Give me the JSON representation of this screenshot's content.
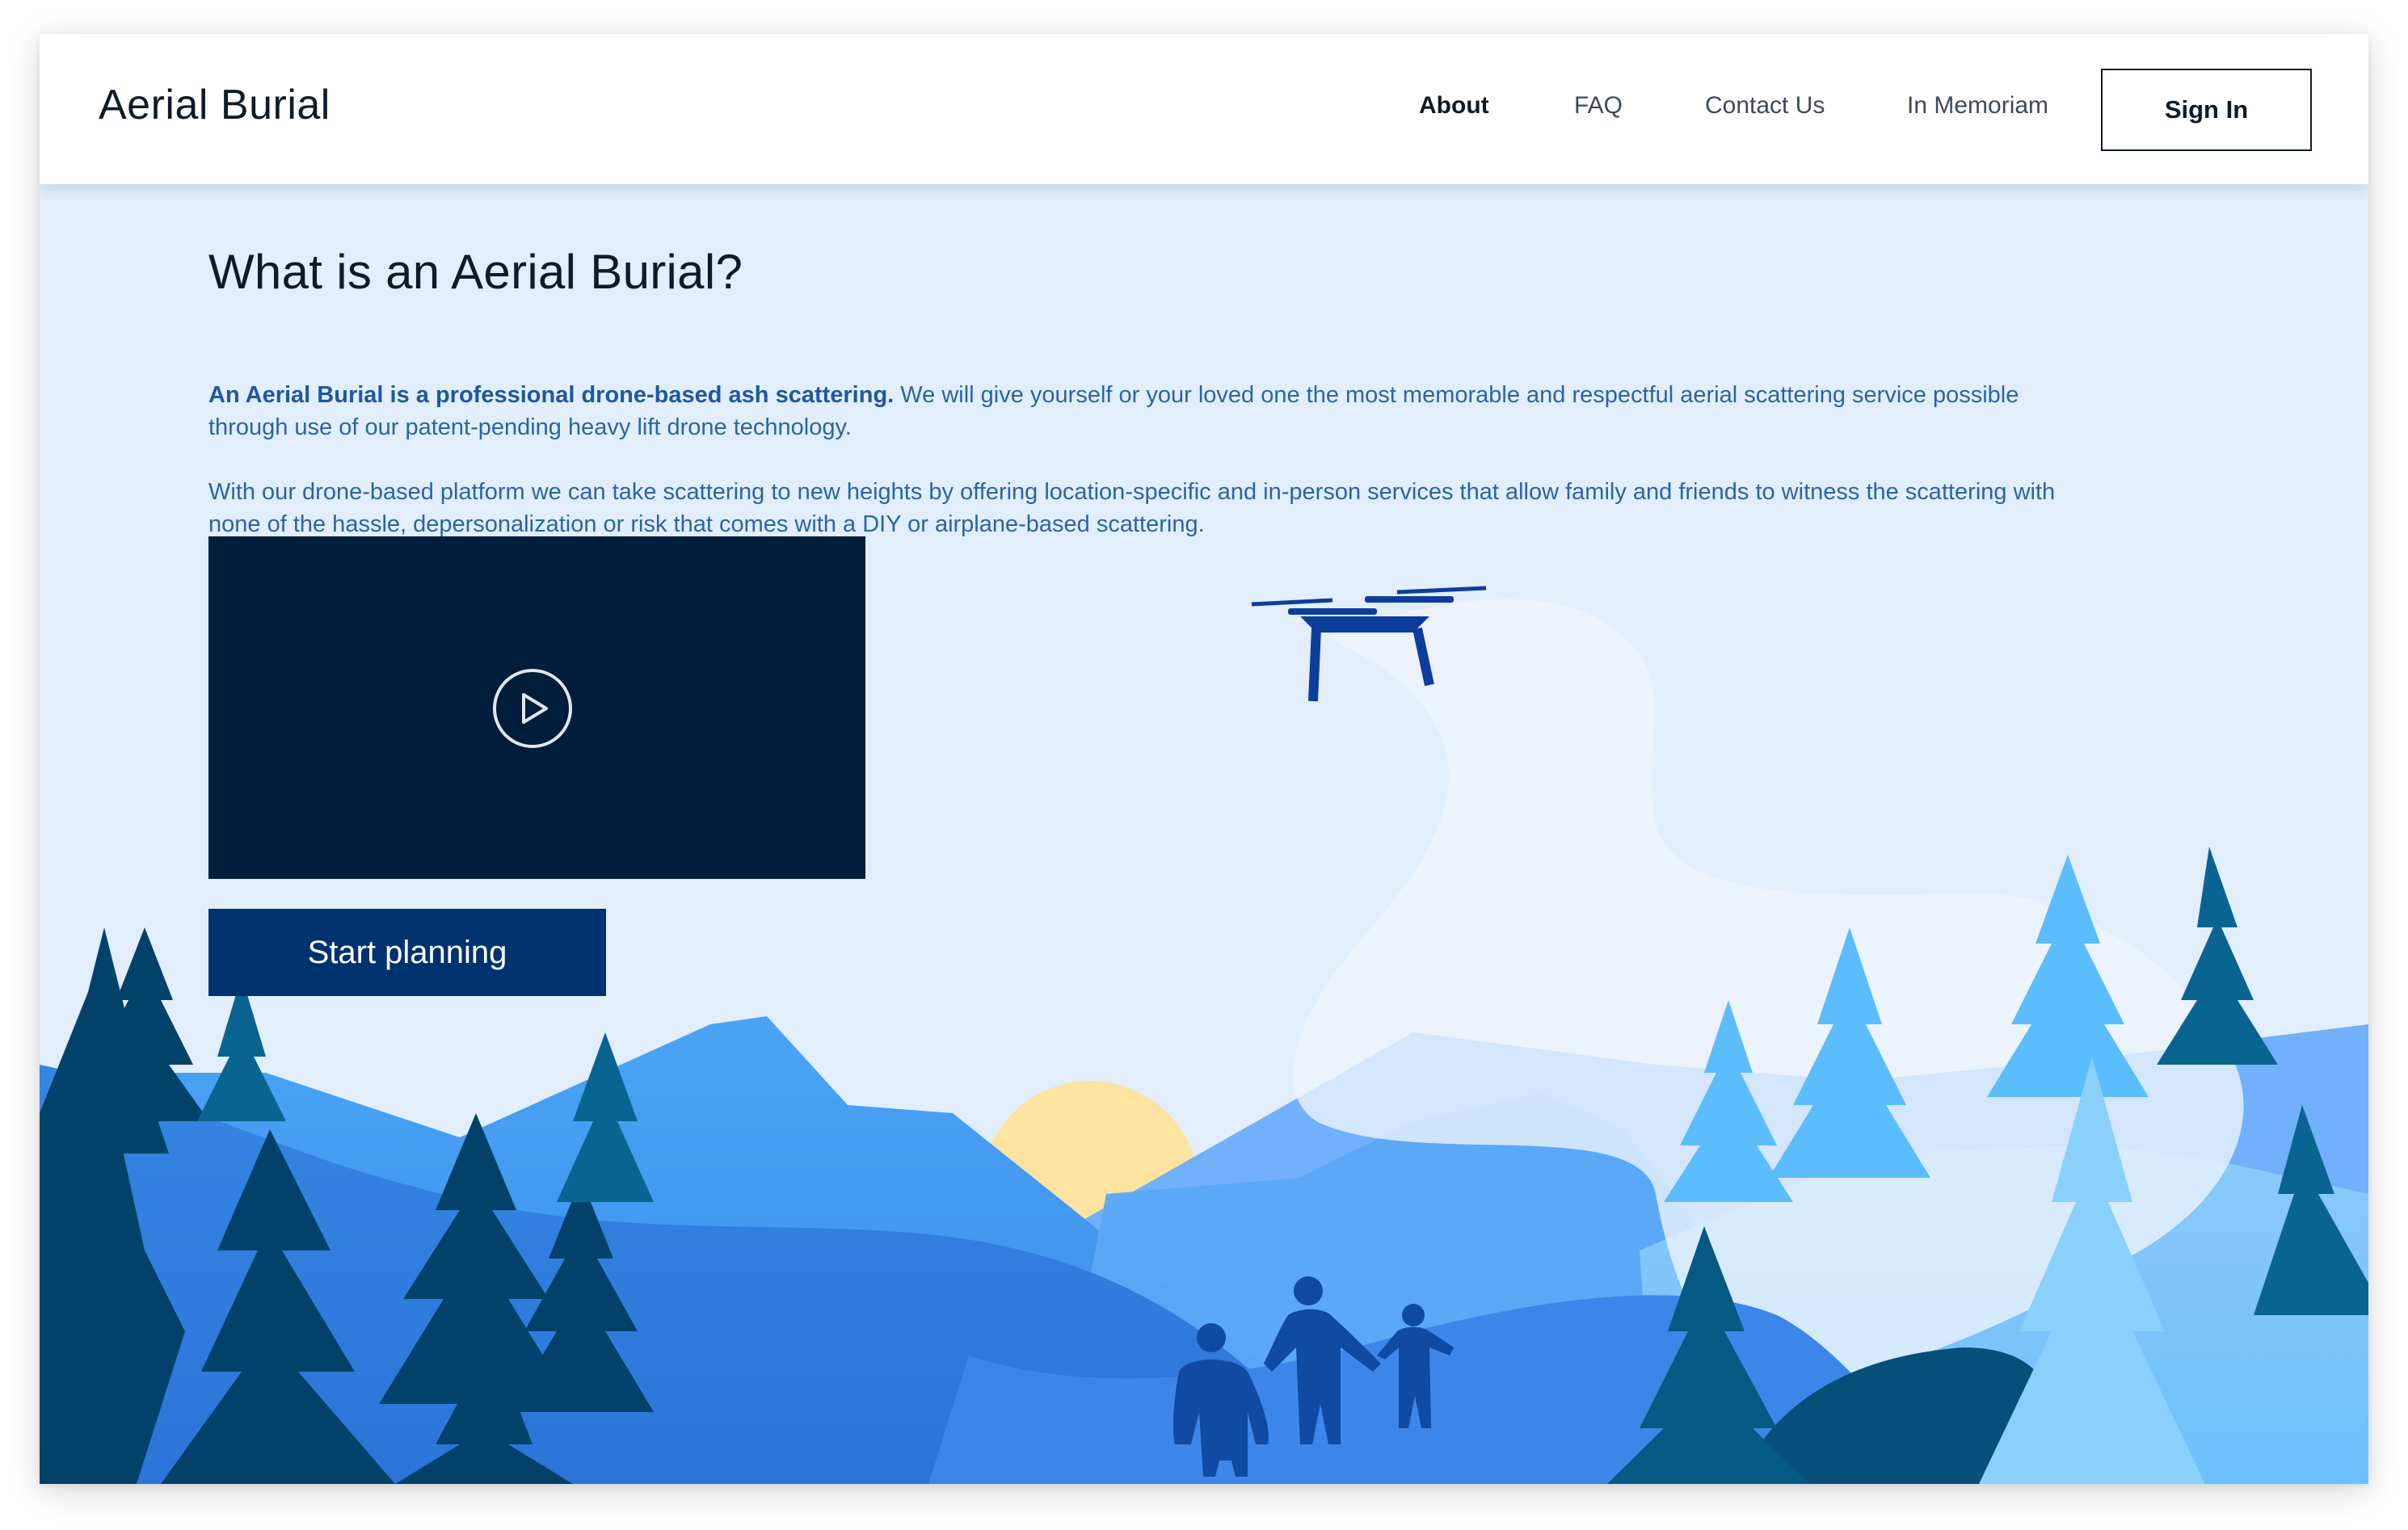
{
  "app": {
    "title": "Aerial Burial"
  },
  "nav": {
    "items": [
      {
        "label": "About",
        "active": true
      },
      {
        "label": "FAQ",
        "active": false
      },
      {
        "label": "Contact Us",
        "active": false
      },
      {
        "label": "In Memoriam",
        "active": false
      }
    ],
    "sign_in_label": "Sign In"
  },
  "main": {
    "heading": "What is an Aerial Burial?",
    "intro_bold": "An Aerial Burial is a professional drone-based ash scattering.",
    "intro_rest_line1": " We will give yourself or your loved one the most memorable and respectful aerial scattering service possible",
    "intro_rest_line2": "through use of our patent-pending heavy lift drone technology.",
    "paragraph2_line1": "With our drone-based platform we can take scattering to new heights by offering location-specific and in-person services that allow family and friends to witness the scattering with",
    "paragraph2_line2": "none of the hassle, depersonalization or risk that comes with a DIY or airplane-based scattering.",
    "video": {
      "icon": "play-icon"
    },
    "cta_label": "Start planning"
  },
  "illustration": {
    "icons": [
      "drone-icon",
      "sun-icon",
      "tree-icon",
      "person-icon"
    ],
    "colors": {
      "sky": "#e2eefc",
      "sun": "#fde3a0",
      "mountain_light": "#71b0fa",
      "mountain_mid": "#47a3f3",
      "mountain_dark": "#2f80dd",
      "tree_dark": "#02426a",
      "tree_light": "#5bbdfc",
      "figures": "#0f4aa3",
      "drone": "#0d3d9c"
    }
  }
}
